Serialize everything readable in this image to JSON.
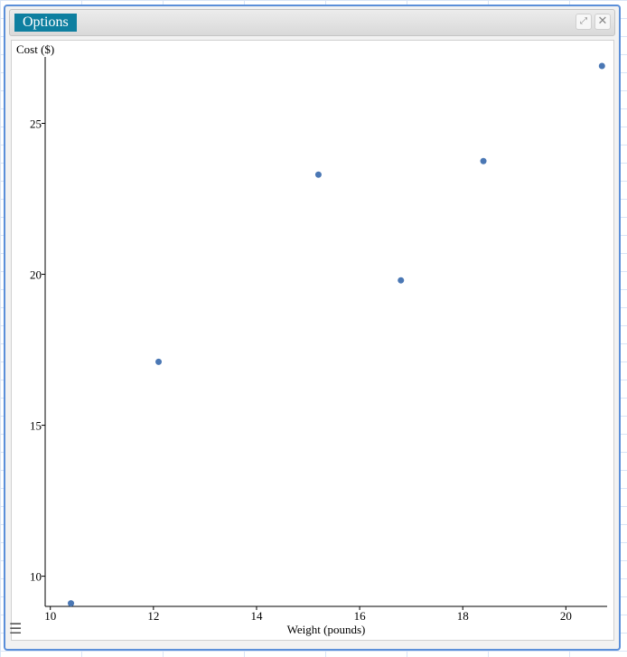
{
  "window": {
    "options_label": "Options",
    "expand_icon": "expand-icon",
    "close_icon": "close-icon",
    "menu_icon": "menu-icon"
  },
  "chart_data": {
    "type": "scatter",
    "xlabel": "Weight (pounds)",
    "ylabel": "Cost ($)",
    "xlim": [
      9.9,
      20.8
    ],
    "ylim": [
      9,
      27.2
    ],
    "x_ticks": [
      10,
      12,
      14,
      16,
      18,
      20
    ],
    "y_ticks": [
      10,
      15,
      20,
      25
    ],
    "grid": false,
    "point_color": "#4a77b4",
    "points": [
      {
        "x": 10.4,
        "y": 9.1
      },
      {
        "x": 12.1,
        "y": 17.1
      },
      {
        "x": 15.2,
        "y": 23.3
      },
      {
        "x": 16.8,
        "y": 19.8
      },
      {
        "x": 18.4,
        "y": 23.75
      },
      {
        "x": 20.7,
        "y": 26.9
      }
    ]
  }
}
